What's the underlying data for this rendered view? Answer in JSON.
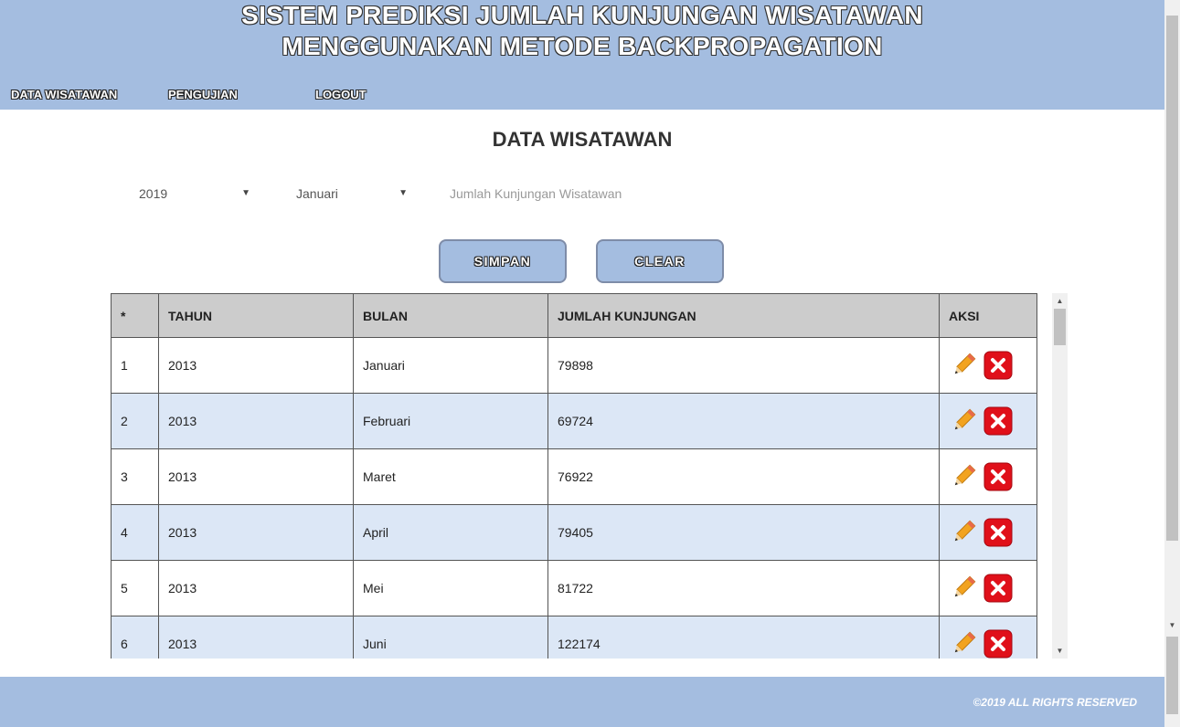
{
  "header": {
    "title_line1": "SISTEM PREDIKSI JUMLAH KUNJUNGAN WISATAWAN",
    "title_line2": "MENGGUNAKAN METODE BACKPROPAGATION"
  },
  "nav": {
    "data_wisatawan": "DATA WISATAWAN",
    "pengujian": "PENGUJIAN",
    "logout": "LOGOUT"
  },
  "main": {
    "heading": "DATA WISATAWAN",
    "year_select": "2019",
    "month_select": "Januari",
    "visitor_input_placeholder": "Jumlah Kunjungan Wisatawan",
    "save_label": "SIMPAN",
    "clear_label": "CLEAR"
  },
  "table": {
    "headers": [
      "*",
      "TAHUN",
      "BULAN",
      "JUMLAH KUNJUNGAN",
      "AKSI"
    ],
    "rows": [
      {
        "no": "1",
        "tahun": "2013",
        "bulan": "Januari",
        "jumlah": "79898"
      },
      {
        "no": "2",
        "tahun": "2013",
        "bulan": "Februari",
        "jumlah": "69724"
      },
      {
        "no": "3",
        "tahun": "2013",
        "bulan": "Maret",
        "jumlah": "76922"
      },
      {
        "no": "4",
        "tahun": "2013",
        "bulan": "April",
        "jumlah": "79405"
      },
      {
        "no": "5",
        "tahun": "2013",
        "bulan": "Mei",
        "jumlah": "81722"
      },
      {
        "no": "6",
        "tahun": "2013",
        "bulan": "Juni",
        "jumlah": "122174"
      }
    ],
    "action_icons": [
      "edit-pencil-icon",
      "delete-x-icon"
    ]
  },
  "footer": {
    "copyright": "©2019 ALL RIGHTS RESERVED"
  },
  "colors": {
    "header_bg": "#a4bde0",
    "row_alt_bg": "#dce7f6",
    "table_header_bg": "#cccccc",
    "delete_red": "#e0101a",
    "pencil_orange": "#f2a31f"
  }
}
